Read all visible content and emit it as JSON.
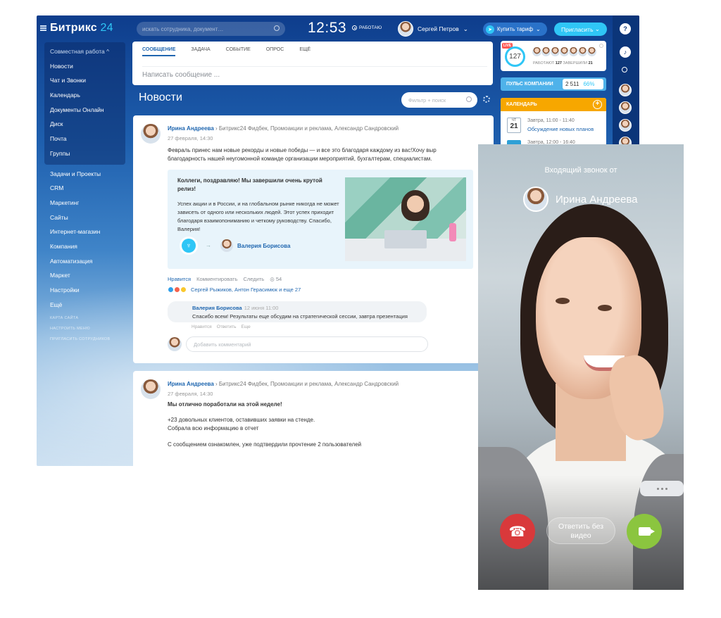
{
  "app": {
    "logo": "Битрикс",
    "logo_num": "24",
    "search_placeholder": "искать сотрудника, документ…",
    "clock": "12:53",
    "status": "РАБОТАЮ",
    "user": "Сергей Петров",
    "buy_btn": "Купить тариф",
    "invite_btn": "Пригласить"
  },
  "sidebar": {
    "group_head": "Совместная работа ^",
    "group": [
      "Новости",
      "Чат и Звонки",
      "Календарь",
      "Документы Онлайн",
      "Диск",
      "Почта",
      "Группы"
    ],
    "items": [
      "Задачи и Проекты",
      "CRM",
      "Маркетинг",
      "Сайты",
      "Интернет-магазин",
      "Компания",
      "Автоматизация",
      "Маркет",
      "Настройки",
      "Ещё"
    ],
    "small": [
      "Карта сайта",
      "Настроить меню",
      "Пригласить сотрудников"
    ]
  },
  "composer": {
    "tabs": [
      "СООБЩЕНИЕ",
      "ЗАДАЧА",
      "СОБЫТИЕ",
      "ОПРОС",
      "ЕЩЁ"
    ],
    "placeholder": "Написать сообщение ..."
  },
  "feed": {
    "title": "Новости",
    "filter_placeholder": "Фильтр + поиск"
  },
  "post1": {
    "author": "Ирина Андреева",
    "to": "Битрикс24 Фидбек, Промоакции и реклама, Александр Сандровский",
    "date": "27 февраля, 14:30",
    "text": "Февраль принес нам новые рекорды и новые победы — и все это благодаря каждому из вас!Хочу выр благодарность нашей неугомонной команде организации мероприятий, бухгалтерам, специалистам.",
    "grat_title": "Коллеги, поздравляю! Мы завершили очень крутой релиз!",
    "grat_body": "Успех акции и в России, и на глобальном рынке никогда не может зависеть от одного или нескольких людей. Этот успех приходит благодаря взаимопониманию и четкому руководству. Спасибо, Валерия!",
    "grat_name": "Валерия Борисова",
    "actions": {
      "like": "Нравится",
      "comment": "Комментировать",
      "follow": "Следить",
      "views": "◎ 54"
    },
    "likers": "Сергей Рыжиков, Антон Герасимюк и еще 27",
    "comment": {
      "author": "Валерия Борисова",
      "date": "12 июня 11:00",
      "text": "Спасибо всем! Результаты еще обсудим на стратегической сессии, завтра презентация",
      "like": "Нравится",
      "reply": "Ответить",
      "more": "Еще"
    },
    "add_comment": "Добавить комментарий"
  },
  "post2": {
    "author": "Ирина Андреева",
    "to": "Битрикс24 Фидбек, Промоакции и реклама, Александр Сандровский",
    "date": "27 февраля, 14:30",
    "bold": "Мы отлично поработали на этой неделе!",
    "l1": "+23 довольных клиентов, оставивших заявки на стенде.",
    "l2": "Собрала всю информацию в отчет",
    "l3": "С сообщением ознакомлен, уже подтвердили прочтение 2 пользователей"
  },
  "pulse": {
    "live": "LIVE",
    "count": "127",
    "working_label": "РАБОТАЮТ",
    "working": "127",
    "done_label": "ЗАВЕРШИЛИ",
    "done": "21",
    "bar": "Пульс компании",
    "value": "2 511",
    "pct": "66%"
  },
  "calendar": {
    "title": "Календарь",
    "day_name": "ЧТ",
    "day": "21",
    "ev_time": "Завтра, 11:00 - 11:40",
    "ev_name": "Обсуждение новых планов",
    "ev2_time": "Завтра, 12:00 - 16:40"
  },
  "call": {
    "incoming": "Входящий звонок от",
    "caller": "Ирина Андреева",
    "audio_btn": "Ответить без видео"
  },
  "colors": {
    "accent": "#2fc6f6",
    "link": "#2067b0",
    "decline": "#d9393b",
    "accept": "#8bc53f",
    "calendar": "#f7a700"
  }
}
